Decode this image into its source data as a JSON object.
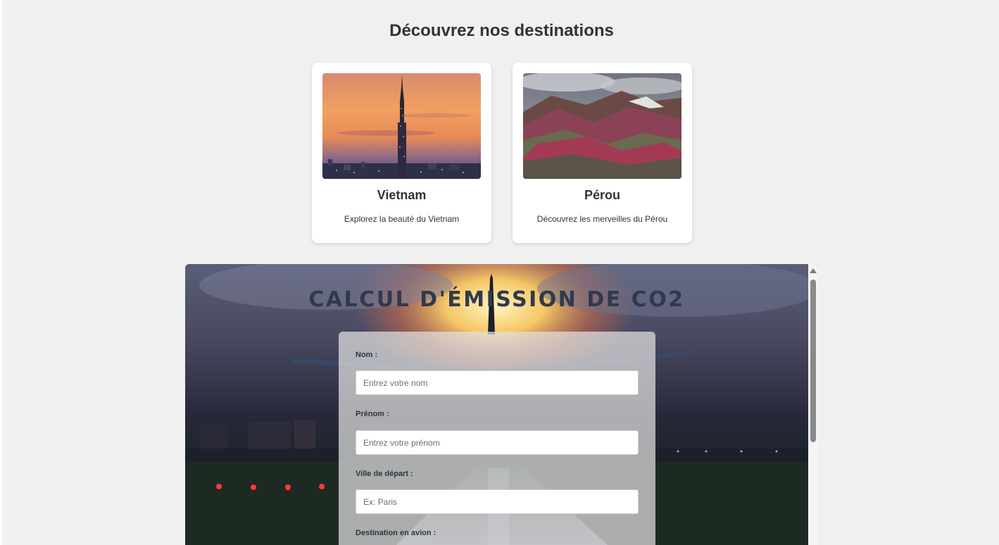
{
  "destinations": {
    "title": "Découvrez nos destinations",
    "cards": [
      {
        "name": "Vietnam",
        "description": "Explorez la beauté du Vietnam",
        "image": "vietnam-skyline-photo"
      },
      {
        "name": "Pérou",
        "description": "Découvrez les merveilles du Pérou",
        "image": "peru-rainbow-mountains-photo"
      }
    ]
  },
  "co2_form": {
    "title": "CALCUL D'ÉMISSION DE CO2",
    "background": "airplane-takeoff-photo",
    "fields": [
      {
        "label": "Nom :",
        "placeholder": "Entrez votre nom"
      },
      {
        "label": "Prénom :",
        "placeholder": "Entrez votre prénom"
      },
      {
        "label": "Ville de départ :",
        "placeholder": "Ex: Paris"
      },
      {
        "label": "Destination en avion :"
      }
    ]
  },
  "colors": {
    "page_bg": "#f0f0f0",
    "title_text": "#333333",
    "form_title": "#2f3a4e"
  }
}
